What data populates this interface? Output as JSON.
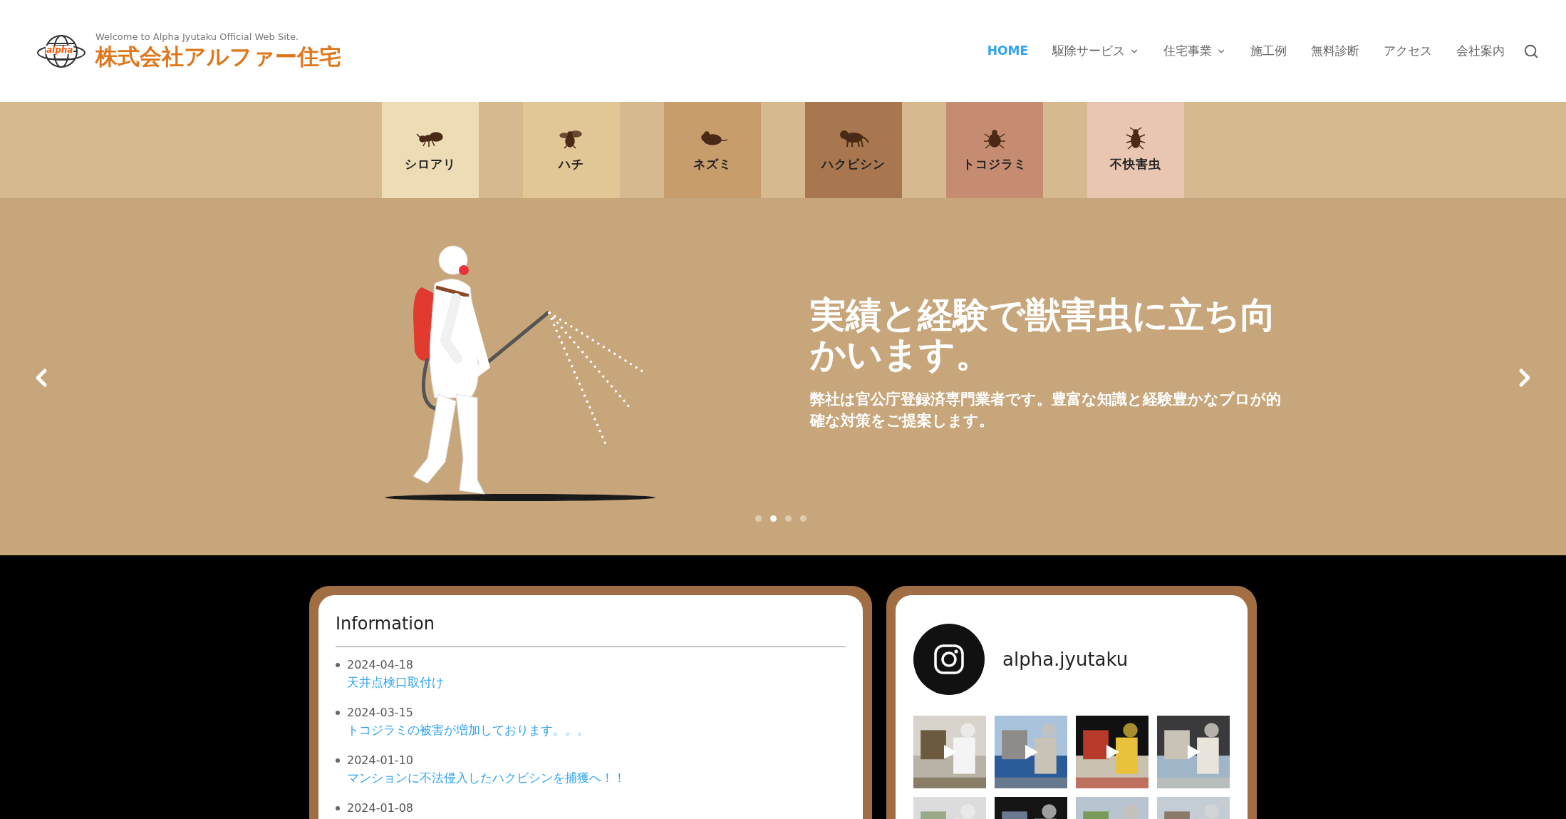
{
  "header": {
    "tagline": "Welcome to Alpha Jyutaku Official Web Site.",
    "company": "株式会社アルファー住宅",
    "badge": "alpha",
    "nav": [
      {
        "label": "HOME",
        "selected": true,
        "dropdown": false
      },
      {
        "label": "駆除サービス",
        "selected": false,
        "dropdown": true
      },
      {
        "label": "住宅事業",
        "selected": false,
        "dropdown": true
      },
      {
        "label": "施工例",
        "selected": false,
        "dropdown": false
      },
      {
        "label": "無料診断",
        "selected": false,
        "dropdown": false
      },
      {
        "label": "アクセス",
        "selected": false,
        "dropdown": false
      },
      {
        "label": "会社案内",
        "selected": false,
        "dropdown": false
      }
    ]
  },
  "categories": [
    {
      "label": "シロアリ",
      "color": "#eddcb6"
    },
    {
      "label": "ハチ",
      "color": "#e2c796"
    },
    {
      "label": "ネズミ",
      "color": "#c79d6c"
    },
    {
      "label": "ハクビシン",
      "color": "#a8774f"
    },
    {
      "label": "トコジラミ",
      "color": "#c58c72"
    },
    {
      "label": "不快害虫",
      "color": "#e9c6b2"
    }
  ],
  "hero": {
    "title": "実績と経験で獣害虫に立ち向かいます。",
    "subtitle": "弊社は官公庁登録済専門業者です。豊富な知識と経験豊かなプロが的確な対策をご提案します。",
    "slides": [
      {
        "selected": false
      },
      {
        "selected": true
      },
      {
        "selected": false
      },
      {
        "selected": false
      }
    ]
  },
  "information": {
    "title": "Information",
    "items": [
      {
        "date": "2024-04-18",
        "title": "天井点検口取付け"
      },
      {
        "date": "2024-03-15",
        "title": "トコジラミの被害が増加しております。。。"
      },
      {
        "date": "2024-01-10",
        "title": "マンションに不法侵入したハクビシンを捕獲へ！！"
      },
      {
        "date": "2024-01-08"
      }
    ]
  },
  "instagram": {
    "username": "alpha.jyutaku",
    "posts": [
      {
        "kind": "video"
      },
      {
        "kind": "video"
      },
      {
        "kind": "video"
      },
      {
        "kind": "video"
      },
      {
        "kind": "picture"
      },
      {
        "kind": "picture"
      },
      {
        "kind": "picture"
      },
      {
        "kind": "picture"
      }
    ]
  }
}
